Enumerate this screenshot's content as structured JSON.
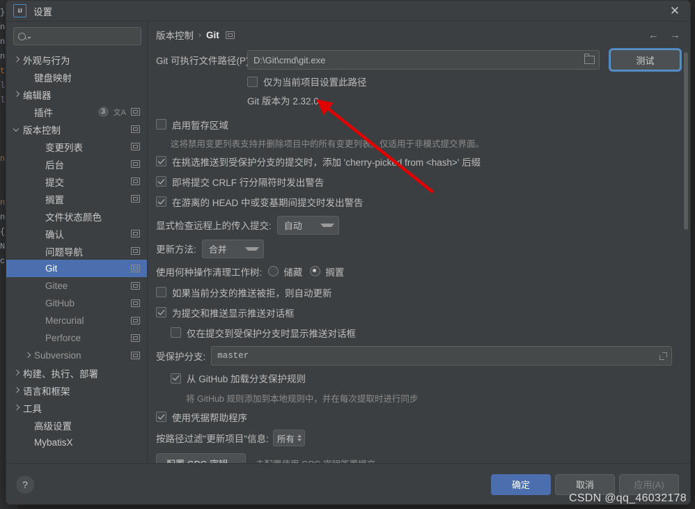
{
  "window": {
    "title": "设置",
    "logo_text": "IJ",
    "close_icon": "✕"
  },
  "sidebar": {
    "search_placeholder": "",
    "search_value": "",
    "items": [
      {
        "label": "外观与行为",
        "indent": 0,
        "arrow": "right",
        "trailing": "",
        "selected": false,
        "dim": false
      },
      {
        "label": "键盘映射",
        "indent": 1,
        "arrow": "",
        "trailing": "",
        "selected": false,
        "dim": false
      },
      {
        "label": "编辑器",
        "indent": 0,
        "arrow": "right",
        "trailing": "",
        "selected": false,
        "dim": false
      },
      {
        "label": "插件",
        "indent": 1,
        "arrow": "",
        "trailing": "badge-translate-copy",
        "badge": "3",
        "selected": false,
        "dim": false
      },
      {
        "label": "版本控制",
        "indent": 0,
        "arrow": "down",
        "trailing": "copy",
        "selected": false,
        "dim": false
      },
      {
        "label": "变更列表",
        "indent": 2,
        "arrow": "",
        "trailing": "copy",
        "selected": false,
        "dim": false
      },
      {
        "label": "后台",
        "indent": 2,
        "arrow": "",
        "trailing": "copy",
        "selected": false,
        "dim": false
      },
      {
        "label": "提交",
        "indent": 2,
        "arrow": "",
        "trailing": "copy",
        "selected": false,
        "dim": false
      },
      {
        "label": "搁置",
        "indent": 2,
        "arrow": "",
        "trailing": "copy",
        "selected": false,
        "dim": false
      },
      {
        "label": "文件状态颜色",
        "indent": 2,
        "arrow": "",
        "trailing": "",
        "selected": false,
        "dim": false
      },
      {
        "label": "确认",
        "indent": 2,
        "arrow": "",
        "trailing": "copy",
        "selected": false,
        "dim": false
      },
      {
        "label": "问题导航",
        "indent": 2,
        "arrow": "",
        "trailing": "copy",
        "selected": false,
        "dim": false
      },
      {
        "label": "Git",
        "indent": 2,
        "arrow": "",
        "trailing": "copy",
        "selected": true,
        "dim": false
      },
      {
        "label": "Gitee",
        "indent": 2,
        "arrow": "",
        "trailing": "copy",
        "selected": false,
        "dim": true
      },
      {
        "label": "GitHub",
        "indent": 2,
        "arrow": "",
        "trailing": "copy",
        "selected": false,
        "dim": true
      },
      {
        "label": "Mercurial",
        "indent": 2,
        "arrow": "",
        "trailing": "copy",
        "selected": false,
        "dim": true
      },
      {
        "label": "Perforce",
        "indent": 2,
        "arrow": "",
        "trailing": "copy",
        "selected": false,
        "dim": true
      },
      {
        "label": "Subversion",
        "indent": 1,
        "arrow": "right",
        "trailing": "copy",
        "selected": false,
        "dim": true
      },
      {
        "label": "构建、执行、部署",
        "indent": 0,
        "arrow": "right",
        "trailing": "",
        "selected": false,
        "dim": false
      },
      {
        "label": "语言和框架",
        "indent": 0,
        "arrow": "right",
        "trailing": "",
        "selected": false,
        "dim": false
      },
      {
        "label": "工具",
        "indent": 0,
        "arrow": "right",
        "trailing": "",
        "selected": false,
        "dim": false
      },
      {
        "label": "高级设置",
        "indent": 1,
        "arrow": "",
        "trailing": "",
        "selected": false,
        "dim": false
      },
      {
        "label": "MybatisX",
        "indent": 1,
        "arrow": "",
        "trailing": "",
        "selected": false,
        "dim": false
      }
    ]
  },
  "breadcrumb": {
    "parent": "版本控制",
    "separator": "›",
    "current": "Git",
    "back_icon": "←",
    "forward_icon": "→"
  },
  "main": {
    "git_path_label": "Git 可执行文件路径(P):",
    "git_path_value": "D:\\Git\\cmd\\git.exe",
    "test_button": "测试",
    "project_only_path": "仅为当前项目设置此路径",
    "git_version_text": "Git 版本为 2.32.0",
    "staging_label": "启用暂存区域",
    "staging_hint": "这将禁用变更列表支持并删除项目中的所有变更列表。仅适用于非模式提交界面。",
    "cherry_pick_label": "在挑选推送到受保护分支的提交时，添加 'cherry-picked from <hash>' 后缀",
    "crlf_warn_label": "即将提交 CRLF 行分隔符时发出警告",
    "detached_head_label": "在游离的 HEAD 中或变基期间提交时发出警告",
    "incoming_label": "显式检查远程上的传入提交:",
    "incoming_value": "自动",
    "update_method_label": "更新方法:",
    "update_method_value": "合并",
    "clean_worktree_label": "使用何种操作清理工作树:",
    "clean_option_stash": "储藏",
    "clean_option_shelve": "搁置",
    "auto_update_label": "如果当前分支的推送被拒，则自动更新",
    "push_dialog_label": "为提交和推送显示推送对话框",
    "push_dialog_protected_label": "仅在提交到受保护分支时显示推送对话框",
    "protected_branch_label": "受保护分支:",
    "protected_branch_value": "master",
    "github_rules_label": "从 GitHub 加载分支保护规则",
    "github_rules_hint": "将 GitHub 规则添加到本地规则中，并在每次提取时进行同步",
    "credential_helper_label": "使用凭据帮助程序",
    "filter_update_label": "按路径过滤\"更新项目\"信息:",
    "filter_update_value": "所有",
    "gpg_button": "配置 GPG 密钥...",
    "gpg_hint": "未配置使用 GPG 密钥签署提交",
    "checkbox_states": {
      "project_only_path": false,
      "staging": false,
      "cherry_pick": true,
      "crlf_warn": true,
      "detached_head": true,
      "auto_update": false,
      "push_dialog": true,
      "push_dialog_protected": false,
      "github_rules": true,
      "credential_helper": true
    },
    "clean_worktree_selected": "搁置"
  },
  "footer": {
    "help_icon": "?",
    "ok": "确定",
    "cancel": "取消",
    "apply": "应用(A)"
  },
  "watermark": "CSDN @qq_46032178",
  "backdrop_code": "}\nn\nn\nn\nt\nl\nl\n\n\n\n\nn\n\n\n\nn\nn\n{\nN\nc",
  "colors": {
    "accent": "#4b6eaf",
    "dialog_bg": "#3c3f41",
    "field_bg": "#45494a",
    "annotation_red": "#e00000"
  }
}
